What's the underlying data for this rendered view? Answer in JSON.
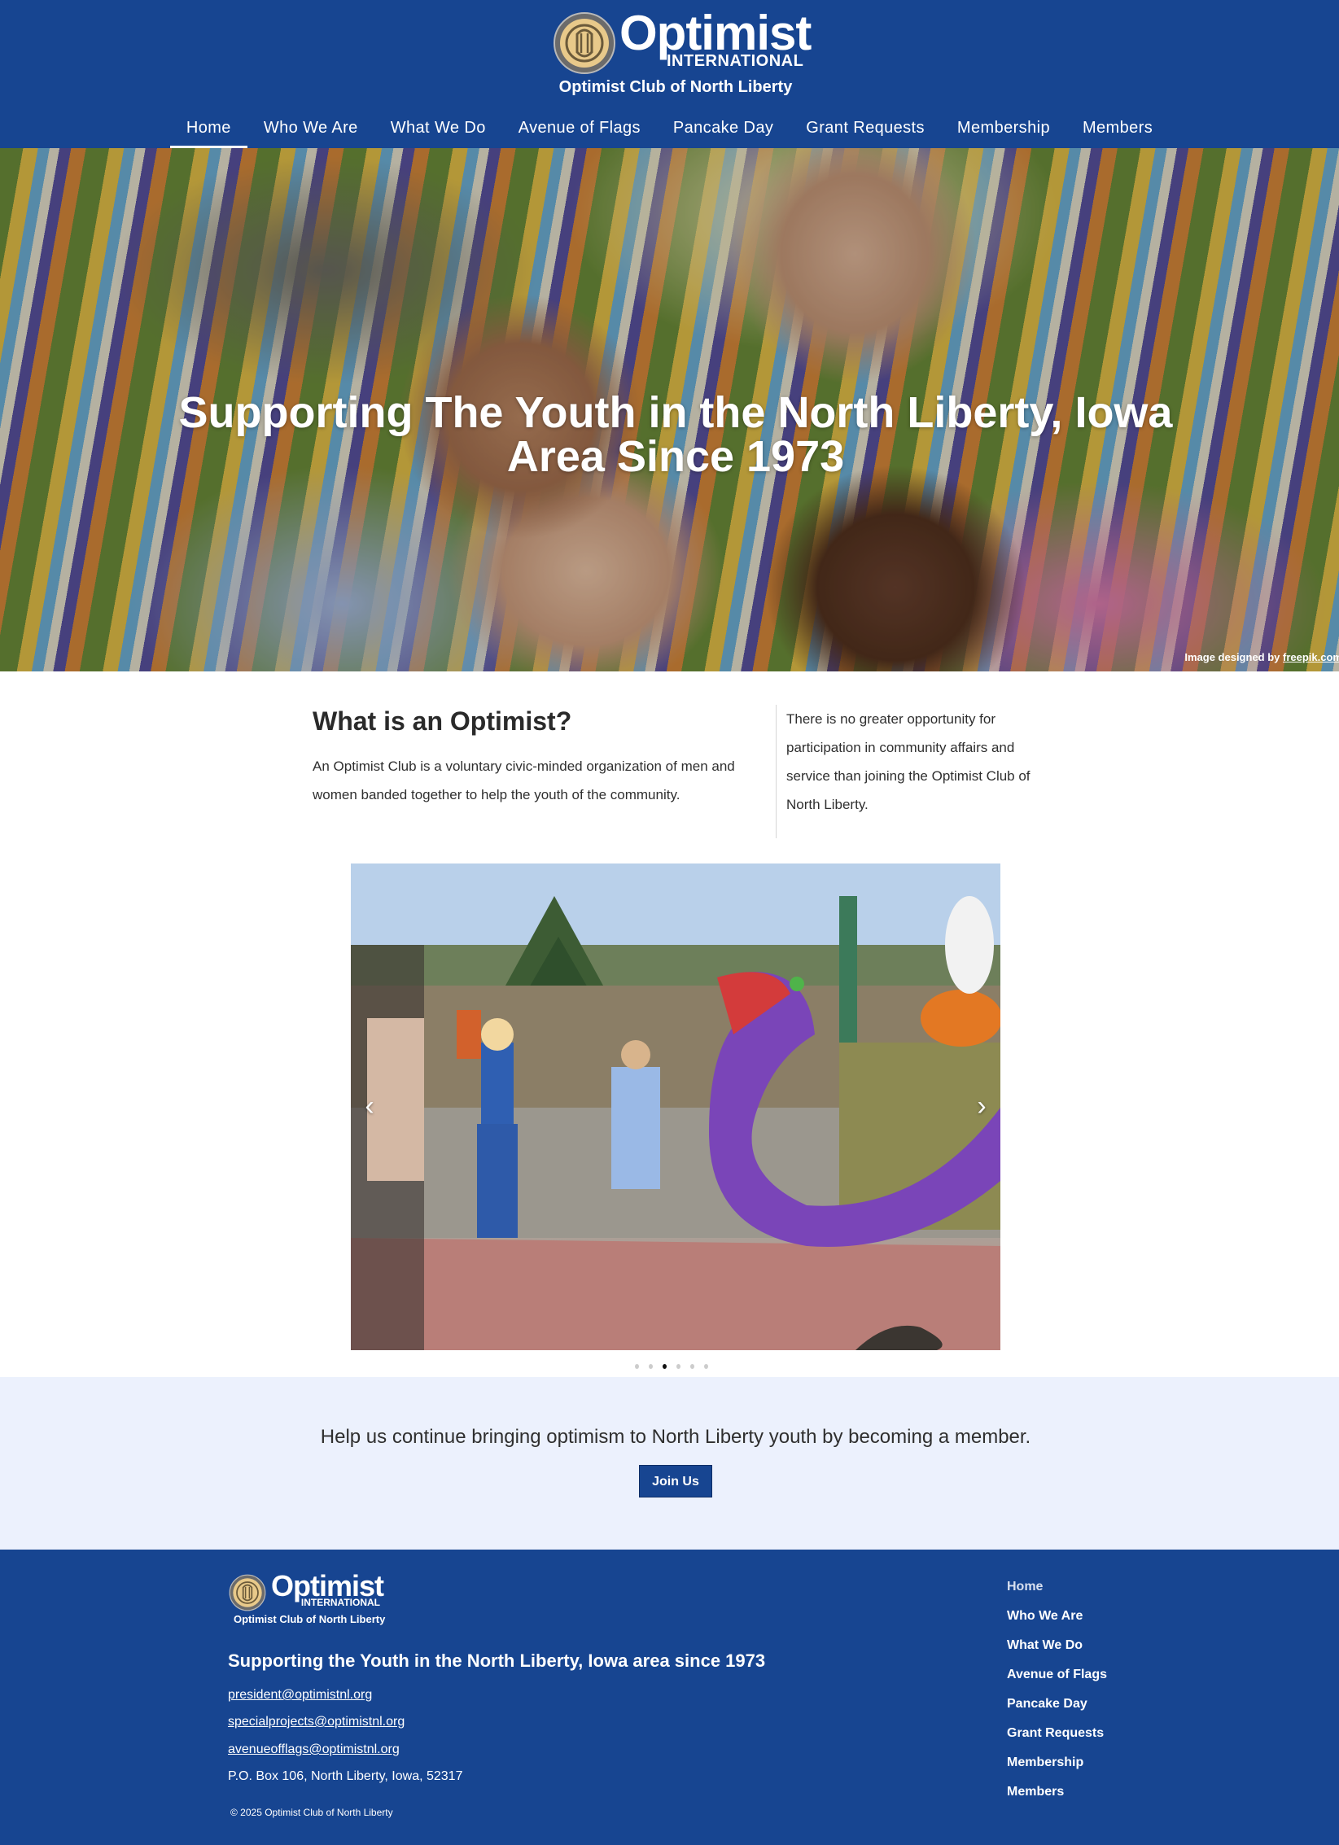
{
  "header": {
    "logo": {
      "word": "Optimist",
      "sub": "INTERNATIONAL",
      "club": "Optimist Club of North Liberty"
    },
    "nav": [
      {
        "label": "Home",
        "active": true
      },
      {
        "label": "Who We Are"
      },
      {
        "label": "What We Do"
      },
      {
        "label": "Avenue of Flags"
      },
      {
        "label": "Pancake Day"
      },
      {
        "label": "Grant Requests"
      },
      {
        "label": "Membership"
      },
      {
        "label": "Members"
      }
    ]
  },
  "hero": {
    "title": "Supporting The Youth in the North Liberty, Iowa Area Since 1973",
    "credit_prefix": "Image designed by ",
    "credit_link": "freepik.com"
  },
  "about": {
    "heading": "What is an Optimist?",
    "text": "An Optimist Club is a voluntary civic-minded organization of men and women banded together to help the youth of the community.",
    "side_text": "There is no greater opportunity for participation in community affairs and service than joining the Optimist Club of North Liberty."
  },
  "carousel": {
    "prev_icon": "‹",
    "next_icon": "›",
    "slide_count": 6,
    "active_slide": 3
  },
  "cta": {
    "text": "Help us continue bringing optimism to North Liberty youth by becoming a member.",
    "button": "Join Us"
  },
  "footer": {
    "logo": {
      "word": "Optimist",
      "sub": "INTERNATIONAL",
      "club": "Optimist Club of North Liberty"
    },
    "tagline": "Supporting the Youth in the North Liberty, Iowa area since 1973",
    "emails": [
      "president@optimistnl.org",
      "specialprojects@optimistnl.org",
      "avenueofflags@optimistnl.org"
    ],
    "address": "P.O. Box 106, North Liberty, Iowa, 52317",
    "copyright": "© 2025 Optimist Club of North Liberty",
    "nav": [
      "Home",
      "Who We Are",
      "What We Do",
      "Avenue of Flags",
      "Pancake Day",
      "Grant Requests",
      "Membership",
      "Members"
    ]
  },
  "colors": {
    "brand_blue": "#174591",
    "cta_background": "#ecf1fd",
    "logo_gold": "#e8c98a"
  }
}
